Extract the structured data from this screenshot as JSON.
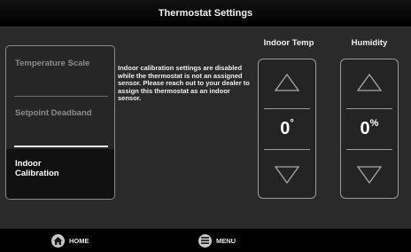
{
  "header": {
    "title": "Thermostat Settings"
  },
  "sidebar": {
    "items": [
      {
        "label": "Temperature Scale",
        "active": false
      },
      {
        "label": "Setpoint Deadband",
        "active": false
      },
      {
        "label": "Indoor Calibration",
        "active": true
      }
    ]
  },
  "info_text": "Indoor calibration settings are disabled while the thermostat is not an assigned sensor. Please reach out to your dealer to assign this thermostat as an indoor sensor.",
  "controls": {
    "indoor_temp": {
      "label": "Indoor Temp",
      "value": "0",
      "unit": "°"
    },
    "humidity": {
      "label": "Humidity",
      "value": "0",
      "unit": "%"
    }
  },
  "bottom_nav": {
    "home_label": "HOME",
    "menu_label": "MENU"
  },
  "icons": {
    "home": "home-icon",
    "menu": "menu-icon",
    "up": "triangle-up-icon",
    "down": "triangle-down-icon"
  },
  "colors": {
    "background": "#2a2a2a",
    "titlebar": "#000000",
    "border": "#9a9a9a",
    "text": "#ffffff",
    "muted_text": "#8c8c8c"
  }
}
